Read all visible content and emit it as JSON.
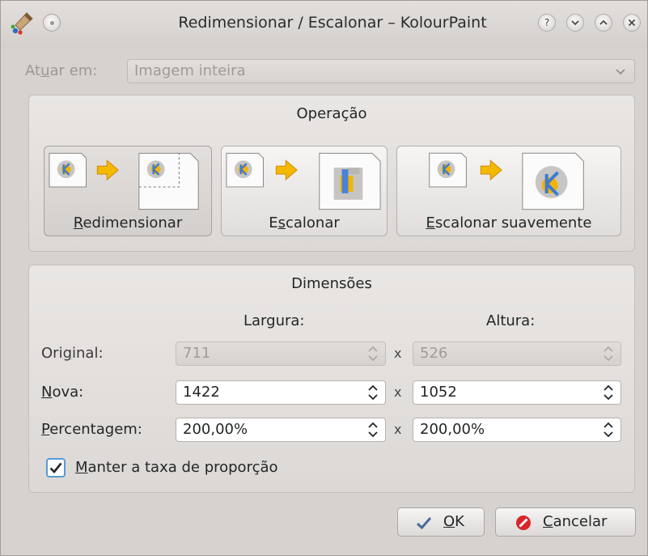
{
  "window": {
    "title": "Redimensionar / Escalonar – KolourPaint",
    "controls": [
      "?",
      "v",
      "^",
      "x"
    ]
  },
  "apply_to": {
    "label_pre": "At",
    "label_mn": "u",
    "label_post": "ar em:",
    "value": "Imagem inteira"
  },
  "operation": {
    "title": "Operação",
    "buttons": [
      {
        "pre": "",
        "mn": "R",
        "post": "edimensionar",
        "selected": true
      },
      {
        "pre": "E",
        "mn": "s",
        "post": "calonar",
        "selected": false
      },
      {
        "pre": "",
        "mn": "E",
        "post": "scalonar suavemente",
        "selected": false
      }
    ]
  },
  "dimensions": {
    "title": "Dimensões",
    "width_header": "Largura:",
    "height_header": "Altura:",
    "separator": "x",
    "rows": [
      {
        "pre": "Ori",
        "mn": "g",
        "post": "inal:",
        "width": "711",
        "height": "526",
        "enabled": false
      },
      {
        "pre": "",
        "mn": "N",
        "post": "ova:",
        "width": "1422",
        "height": "1052",
        "enabled": true
      },
      {
        "pre": "",
        "mn": "P",
        "post": "ercentagem:",
        "width": "200,00%",
        "height": "200,00%",
        "enabled": true
      }
    ],
    "keep_aspect": {
      "pre": "",
      "mn": "M",
      "post": "anter a taxa de proporção",
      "checked": true
    }
  },
  "buttons": {
    "ok": {
      "pre": "",
      "mn": "O",
      "post": "K"
    },
    "cancel": {
      "pre": "",
      "mn": "C",
      "post": "ancelar"
    }
  },
  "colors": {
    "accent": "#5a9ad6",
    "arrow": "#f5b800",
    "cancel_icon": "#d9262b"
  }
}
